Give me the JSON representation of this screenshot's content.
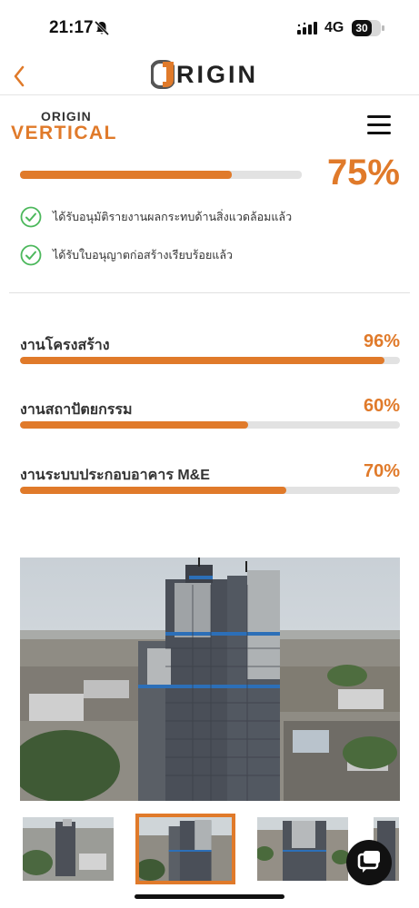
{
  "status_bar": {
    "time": "21:17",
    "network": "4G",
    "battery": "30"
  },
  "header": {
    "brand": "RIGIN",
    "back_icon": "chevron-left-icon"
  },
  "project": {
    "logo_top": "ORIGIN",
    "logo_bottom": "VERTICAL",
    "menu_icon": "hamburger-icon"
  },
  "progress": {
    "overall_percent_label": "75%",
    "overall_value": 75,
    "checks": [
      {
        "text": "ได้รับอนุมัติรายงานผลกระทบด้านสิ่งแวดล้อมแล้ว",
        "icon": "check-circle-icon"
      },
      {
        "text": "ได้รับใบอนุญาตก่อสร้างเรียบร้อยแล้ว",
        "icon": "check-circle-icon"
      }
    ],
    "works": [
      {
        "label": "งานโครงสร้าง",
        "percent_label": "96%",
        "value": 96
      },
      {
        "label": "งานสถาปัตยกรรม",
        "percent_label": "60%",
        "value": 60
      },
      {
        "label": "งานระบบประกอบอาคาร M&E",
        "percent_label": "70%",
        "value": 70
      }
    ]
  },
  "gallery": {
    "thumbnail_count": 4,
    "active_index": 1
  },
  "chat": {
    "icon": "chat-bubble-icon"
  },
  "colors": {
    "accent": "#e07a2a",
    "check": "#4cb85c",
    "track": "#e2e2e2"
  }
}
